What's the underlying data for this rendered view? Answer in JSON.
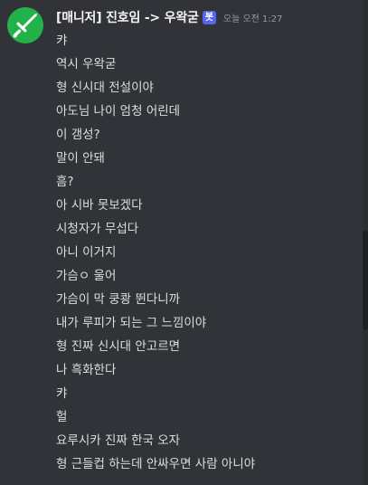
{
  "message": {
    "username": "[매니저] 진호임 -> 우왁굳",
    "bot_tag": "봇",
    "timestamp": "오늘 오전 1:27",
    "avatar_icon": "sword-icon",
    "lines": [
      "캬",
      "역시 우왁굳",
      "형 신시대 전설이야",
      "아도님 나이 엄청 어린데",
      "이 갬성?",
      "말이 안돼",
      "흠?",
      "아 시바 못보겠다",
      "시청자가 무섭다",
      "아니 이거지",
      "가슴ㅇ 울어",
      "가슴이 막 쿵쾅 뛴다니까",
      "내가 루피가 되는 그 느낌이야",
      "형 진짜 신시대 안고르면",
      "나 흑화한다",
      "캬",
      "헐",
      "요루시카 진짜 한국 오자",
      "형 근들컵 하는데 안싸우면 사람 아니야"
    ]
  },
  "colors": {
    "background": "#313338",
    "avatar": "#21b24a",
    "bot_tag": "#5865f2",
    "text": "#dbdee1",
    "username": "#f2f3f5",
    "timestamp": "#949ba4"
  }
}
